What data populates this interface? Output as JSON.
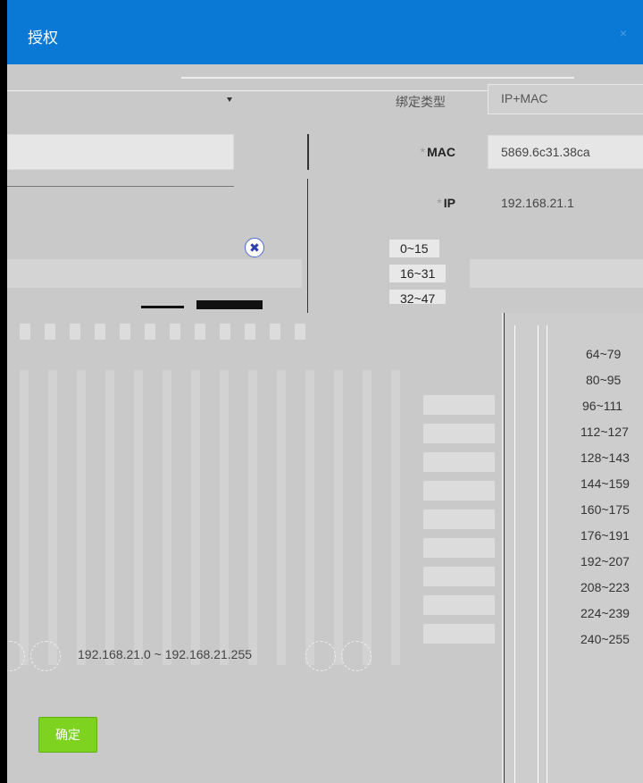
{
  "dialog": {
    "title": "授权",
    "close_icon": "×"
  },
  "form": {
    "auth_type_label": "绑定类型",
    "auth_type_value": "IP+MAC",
    "mac_label": "MAC",
    "mac_value": "5869.6c31.38ca",
    "ip_label": "IP",
    "ip_value": "192.168.21.1",
    "required_mark": "*"
  },
  "ranges_left": [
    "0~15",
    "16~31",
    "32~47"
  ],
  "ranges_right": [
    "64~79",
    "80~95",
    "96~111",
    "112~127",
    "128~143",
    "144~159",
    "160~175",
    "176~191",
    "192~207",
    "208~223",
    "224~239",
    "240~255"
  ],
  "pager": {
    "range_text": "192.168.21.0 ~ 192.168.21.255"
  },
  "footer": {
    "confirm_label": "确定"
  },
  "colors": {
    "titlebar": "#0a79d6",
    "confirm": "#7ed321"
  }
}
